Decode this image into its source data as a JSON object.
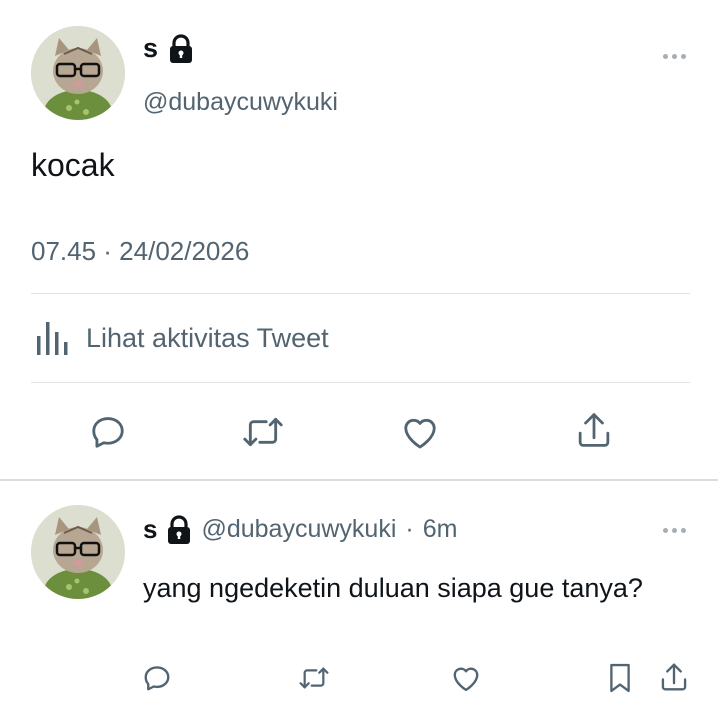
{
  "main_tweet": {
    "display_name": "s",
    "handle": "@dubaycuwykuki",
    "text": "kocak",
    "timestamp": "07.45 · 24/02/2026",
    "activity_label": "Lihat aktivitas Tweet"
  },
  "reply": {
    "display_name": "s",
    "handle": "@dubaycuwykuki",
    "separator": "·",
    "time": "6m",
    "text": "yang ngedeketin duluan siapa gue tanya?"
  },
  "icons": [
    "lock-icon",
    "more-icon",
    "analytics-icon",
    "reply-icon",
    "retweet-icon",
    "like-icon",
    "share-icon",
    "bookmark-icon"
  ],
  "colors": {
    "text": "#0f1419",
    "secondary": "#536471",
    "divider": "#e1e4e6"
  }
}
